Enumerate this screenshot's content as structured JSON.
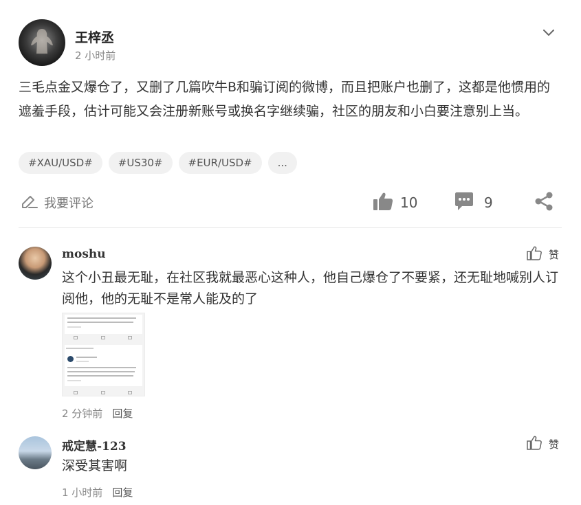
{
  "post": {
    "author": "王梓丞",
    "time": "2 小时前",
    "text": "三毛点金又爆仓了，又删了几篇吹牛B和骗订阅的微博，而且把账户也删了，这都是他惯用的遮羞手段，估计可能又会注册新账号或换名字继续骗，社区的朋友和小白要注意别上当。",
    "tags": [
      "#XAU/USD#",
      "#US30#",
      "#EUR/USD#",
      "..."
    ]
  },
  "actions": {
    "comment_label": "我要评论",
    "like_count": "10",
    "reply_count": "9"
  },
  "comments": [
    {
      "name": "moshu",
      "text": "这个小丑最无耻，在社区我就最恶心这种人，他自己爆仓了不要紧，还无耻地喊别人订阅他，他的无耻不是常人能及的了",
      "time": "2 分钟前",
      "reply": "回复",
      "like_label": "赞"
    },
    {
      "name": "戒定慧-123",
      "text": "深受其害啊",
      "time": "1 小时前",
      "reply": "回复",
      "like_label": "赞"
    }
  ],
  "icons": {
    "menu": "chevron-down-icon",
    "comment": "edit-icon",
    "like": "thumbs-up-icon",
    "reply": "chat-bubble-icon",
    "share": "share-icon"
  },
  "colors": {
    "text": "#333333",
    "muted": "#888888",
    "tag_bg": "#f1f1f1",
    "icon": "#777777"
  }
}
